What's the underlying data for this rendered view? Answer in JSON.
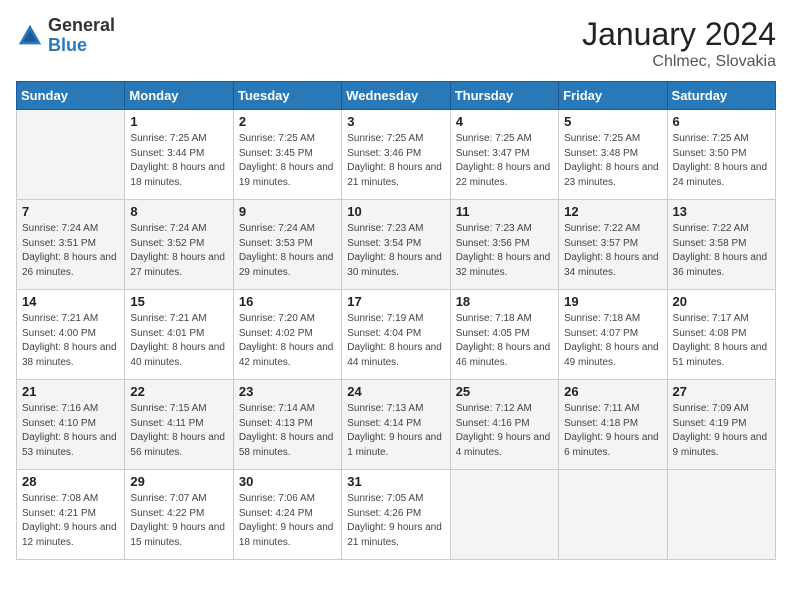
{
  "header": {
    "logo_general": "General",
    "logo_blue": "Blue",
    "month_title": "January 2024",
    "location": "Chlmec, Slovakia"
  },
  "days_of_week": [
    "Sunday",
    "Monday",
    "Tuesday",
    "Wednesday",
    "Thursday",
    "Friday",
    "Saturday"
  ],
  "weeks": [
    [
      {
        "day": "",
        "empty": true
      },
      {
        "day": "1",
        "sunrise": "7:25 AM",
        "sunset": "3:44 PM",
        "daylight": "8 hours and 18 minutes."
      },
      {
        "day": "2",
        "sunrise": "7:25 AM",
        "sunset": "3:45 PM",
        "daylight": "8 hours and 19 minutes."
      },
      {
        "day": "3",
        "sunrise": "7:25 AM",
        "sunset": "3:46 PM",
        "daylight": "8 hours and 21 minutes."
      },
      {
        "day": "4",
        "sunrise": "7:25 AM",
        "sunset": "3:47 PM",
        "daylight": "8 hours and 22 minutes."
      },
      {
        "day": "5",
        "sunrise": "7:25 AM",
        "sunset": "3:48 PM",
        "daylight": "8 hours and 23 minutes."
      },
      {
        "day": "6",
        "sunrise": "7:25 AM",
        "sunset": "3:50 PM",
        "daylight": "8 hours and 24 minutes."
      }
    ],
    [
      {
        "day": "7",
        "sunrise": "7:24 AM",
        "sunset": "3:51 PM",
        "daylight": "8 hours and 26 minutes."
      },
      {
        "day": "8",
        "sunrise": "7:24 AM",
        "sunset": "3:52 PM",
        "daylight": "8 hours and 27 minutes."
      },
      {
        "day": "9",
        "sunrise": "7:24 AM",
        "sunset": "3:53 PM",
        "daylight": "8 hours and 29 minutes."
      },
      {
        "day": "10",
        "sunrise": "7:23 AM",
        "sunset": "3:54 PM",
        "daylight": "8 hours and 30 minutes."
      },
      {
        "day": "11",
        "sunrise": "7:23 AM",
        "sunset": "3:56 PM",
        "daylight": "8 hours and 32 minutes."
      },
      {
        "day": "12",
        "sunrise": "7:22 AM",
        "sunset": "3:57 PM",
        "daylight": "8 hours and 34 minutes."
      },
      {
        "day": "13",
        "sunrise": "7:22 AM",
        "sunset": "3:58 PM",
        "daylight": "8 hours and 36 minutes."
      }
    ],
    [
      {
        "day": "14",
        "sunrise": "7:21 AM",
        "sunset": "4:00 PM",
        "daylight": "8 hours and 38 minutes."
      },
      {
        "day": "15",
        "sunrise": "7:21 AM",
        "sunset": "4:01 PM",
        "daylight": "8 hours and 40 minutes."
      },
      {
        "day": "16",
        "sunrise": "7:20 AM",
        "sunset": "4:02 PM",
        "daylight": "8 hours and 42 minutes."
      },
      {
        "day": "17",
        "sunrise": "7:19 AM",
        "sunset": "4:04 PM",
        "daylight": "8 hours and 44 minutes."
      },
      {
        "day": "18",
        "sunrise": "7:18 AM",
        "sunset": "4:05 PM",
        "daylight": "8 hours and 46 minutes."
      },
      {
        "day": "19",
        "sunrise": "7:18 AM",
        "sunset": "4:07 PM",
        "daylight": "8 hours and 49 minutes."
      },
      {
        "day": "20",
        "sunrise": "7:17 AM",
        "sunset": "4:08 PM",
        "daylight": "8 hours and 51 minutes."
      }
    ],
    [
      {
        "day": "21",
        "sunrise": "7:16 AM",
        "sunset": "4:10 PM",
        "daylight": "8 hours and 53 minutes."
      },
      {
        "day": "22",
        "sunrise": "7:15 AM",
        "sunset": "4:11 PM",
        "daylight": "8 hours and 56 minutes."
      },
      {
        "day": "23",
        "sunrise": "7:14 AM",
        "sunset": "4:13 PM",
        "daylight": "8 hours and 58 minutes."
      },
      {
        "day": "24",
        "sunrise": "7:13 AM",
        "sunset": "4:14 PM",
        "daylight": "9 hours and 1 minute."
      },
      {
        "day": "25",
        "sunrise": "7:12 AM",
        "sunset": "4:16 PM",
        "daylight": "9 hours and 4 minutes."
      },
      {
        "day": "26",
        "sunrise": "7:11 AM",
        "sunset": "4:18 PM",
        "daylight": "9 hours and 6 minutes."
      },
      {
        "day": "27",
        "sunrise": "7:09 AM",
        "sunset": "4:19 PM",
        "daylight": "9 hours and 9 minutes."
      }
    ],
    [
      {
        "day": "28",
        "sunrise": "7:08 AM",
        "sunset": "4:21 PM",
        "daylight": "9 hours and 12 minutes."
      },
      {
        "day": "29",
        "sunrise": "7:07 AM",
        "sunset": "4:22 PM",
        "daylight": "9 hours and 15 minutes."
      },
      {
        "day": "30",
        "sunrise": "7:06 AM",
        "sunset": "4:24 PM",
        "daylight": "9 hours and 18 minutes."
      },
      {
        "day": "31",
        "sunrise": "7:05 AM",
        "sunset": "4:26 PM",
        "daylight": "9 hours and 21 minutes."
      },
      {
        "day": "",
        "empty": true
      },
      {
        "day": "",
        "empty": true
      },
      {
        "day": "",
        "empty": true
      }
    ]
  ],
  "labels": {
    "sunrise_prefix": "Sunrise: ",
    "sunset_prefix": "Sunset: ",
    "daylight_prefix": "Daylight: "
  }
}
